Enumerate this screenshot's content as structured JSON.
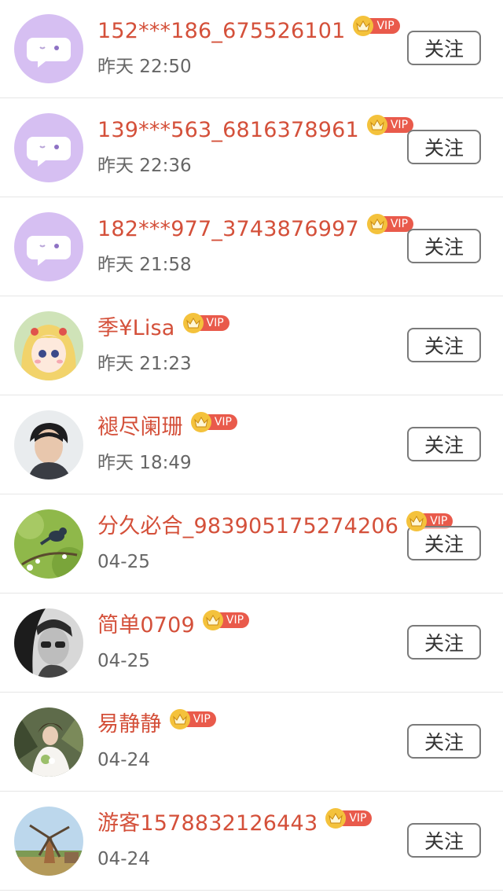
{
  "follow_label": "关注",
  "vip_label": "VIP",
  "users": [
    {
      "name": "152***186_675526101",
      "time": "昨天 22:50",
      "avatar": "default-chat-avatar"
    },
    {
      "name": "139***563_6816378961",
      "time": "昨天 22:36",
      "avatar": "default-chat-avatar"
    },
    {
      "name": "182***977_3743876997",
      "time": "昨天 21:58",
      "avatar": "default-chat-avatar"
    },
    {
      "name": "季¥Lisa",
      "time": "昨天 21:23",
      "avatar": "anime-girl-avatar"
    },
    {
      "name": "褪尽阑珊",
      "time": "昨天 18:49",
      "avatar": "young-man-photo-avatar"
    },
    {
      "name": "分久必合_983905175274206",
      "time": "04-25",
      "avatar": "bird-on-branch-avatar"
    },
    {
      "name": "简单0709",
      "time": "04-25",
      "avatar": "woman-sunglasses-bw-avatar"
    },
    {
      "name": "易静静",
      "time": "04-24",
      "avatar": "bride-flowers-avatar"
    },
    {
      "name": "游客1578832126443",
      "time": "04-24",
      "avatar": "windmill-landscape-avatar"
    }
  ],
  "colors": {
    "name": "#d4503a",
    "time": "#666666",
    "vip_crown": "#f4c23c",
    "vip_tag": "#e95a4b",
    "default_avatar_bg": "#d6bff2",
    "divider": "#e6e6e6"
  }
}
